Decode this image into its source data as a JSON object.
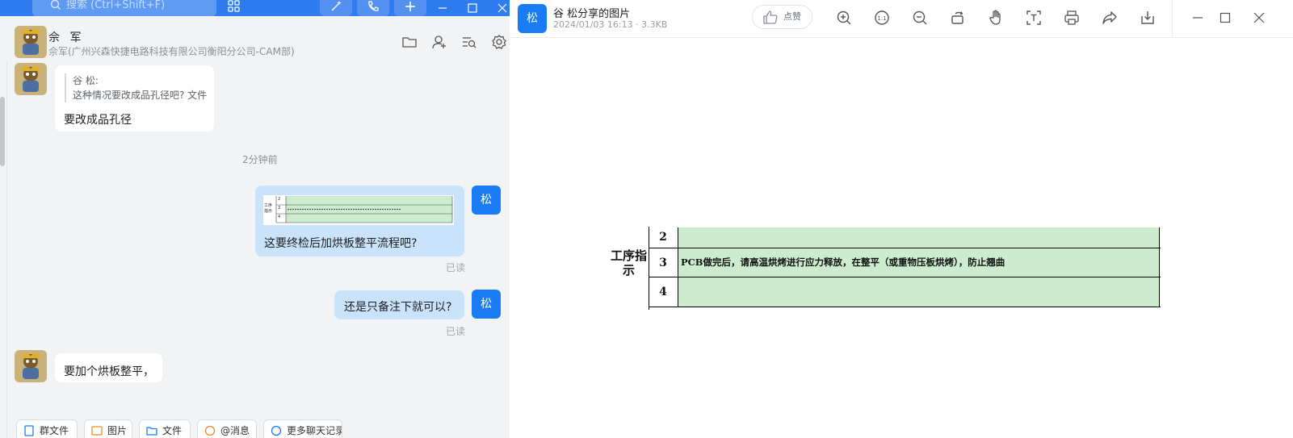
{
  "chat": {
    "search_placeholder": "搜索 (Ctrl+Shift+F)",
    "header": {
      "name": "佘 军",
      "subtitle": "佘军(广州兴森快捷电路科技有限公司衡阳分公司-CAM部)"
    },
    "messages": {
      "msg1": {
        "quote_author": "谷 松:",
        "quote_text": "这种情况要改成品孔径吧? 文件",
        "text": "要改成品孔径"
      },
      "time_separator": "2分钟前",
      "msg2": {
        "text": "这要终检后加烘板整平流程吧?",
        "read": "已读",
        "thumb_label": "工序指示",
        "thumb_rows": [
          "2",
          "3",
          "4"
        ]
      },
      "msg3": {
        "text": "还是只备注下就可以?",
        "read": "已读"
      },
      "msg4": {
        "text": "要加个烘板整平，"
      },
      "self_avatar": "松"
    },
    "bottom_tabs": [
      "群文件",
      "图片",
      "文件",
      "@消息",
      "更多聊天记录"
    ]
  },
  "viewer": {
    "avatar": "松",
    "title": "谷 松分享的图片",
    "meta": "2024/01/03 16:13 · 3.3KB",
    "like_label": "点赞",
    "image": {
      "section_label": "工序指示",
      "rows": [
        {
          "num": "2",
          "text": ""
        },
        {
          "num": "3",
          "text": "PCB做完后，请高温烘烤进行应力释放，在整平（或重物压板烘烤），防止翘曲"
        },
        {
          "num": "4",
          "text": ""
        }
      ],
      "cell_color": "#cdebce"
    }
  },
  "colors": {
    "accent": "#1a7cf5",
    "topbar": "#2f7cf0",
    "self_bubble": "#c9e3fb"
  }
}
